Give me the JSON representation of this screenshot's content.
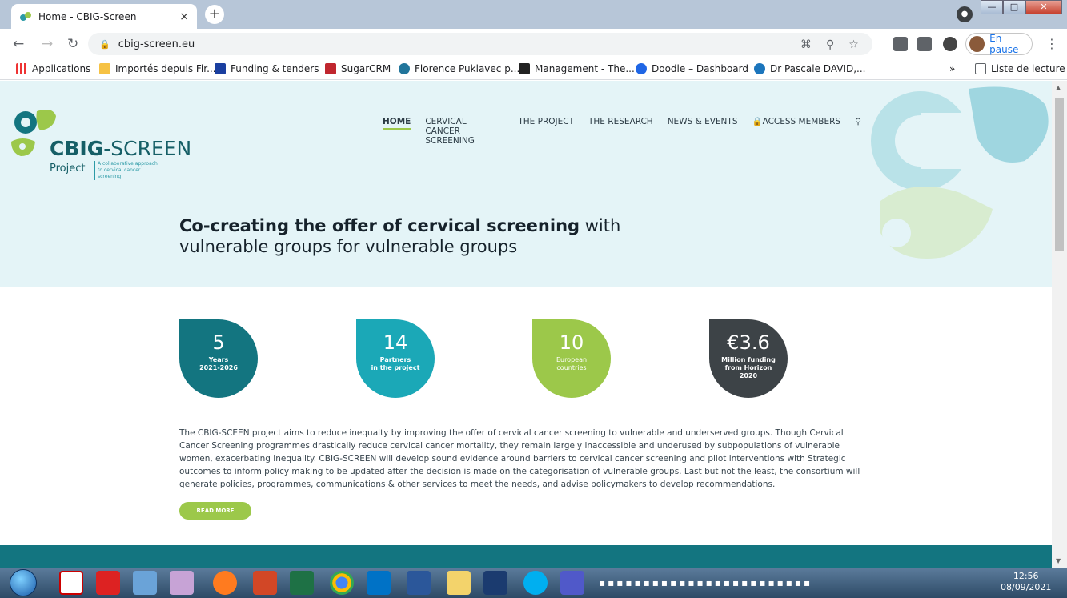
{
  "browser": {
    "tab_title": "Home - CBIG-Screen",
    "tab_close": "×",
    "new_tab": "+",
    "url": "cbig-screen.eu",
    "profile_status": "En pause",
    "bookmarks": [
      "Applications",
      "Importés depuis Fir...",
      "Funding & tenders",
      "SugarCRM",
      "Florence Puklavec p...",
      "Management - The...",
      "Doodle – Dashboard",
      "Dr Pascale DAVID,...",
      "»",
      "Liste de lecture"
    ]
  },
  "site": {
    "logo_brand": "CBIG",
    "logo_suffix": "-SCREEN",
    "logo_project": "Project",
    "logo_tagline": "A collaborative approach to cervical cancer screening",
    "nav": [
      "HOME",
      "CERVICAL CANCER SCREENING",
      "THE PROJECT",
      "THE RESEARCH",
      "NEWS & EVENTS",
      "ACCESS MEMBERS"
    ],
    "hero_bold": "Co-creating the offer of cervical screening",
    "hero_rest_1": " with",
    "hero_rest_2": "vulnerable groups for vulnerable groups",
    "stats": [
      {
        "num": "5",
        "lbl1": "Years",
        "lbl2": "2021-2026",
        "color": "#137580"
      },
      {
        "num": "14",
        "lbl1": "Partners",
        "lbl2": "in the project",
        "color": "#1ba8b7"
      },
      {
        "num": "10",
        "lbl1": "European",
        "lbl2": "countries",
        "color": "#9cc84a"
      },
      {
        "num": "€3.6",
        "lbl1": "Million funding",
        "lbl2": "from Horizon",
        "lbl3": "2020",
        "color": "#3d4347"
      }
    ],
    "description": "The CBIG-SCEEN project aims to reduce inequalty by improving the offer of cervical cancer screening to vulnerable and underserved groups. Though Cervical Cancer Screening programmes drastically reduce cervical cancer mortality, they remain largely inaccessible and underused by subpopulations of vulnerable women, exacerbating inequality. CBIG-SCREEN will develop sound evidence around barriers to cervical cancer screening and pilot interventions with Strategic outcomes to inform policy making to be updated after the decision is made on the categorisation of vulnerable groups. Last but not the least, the consortium will generate policies, programmes, communications & other services to meet the needs, and advise policymakers to develop recommendations.",
    "read_more": "READ MORE"
  },
  "taskbar": {
    "time": "12:56",
    "date": "08/09/2021"
  }
}
